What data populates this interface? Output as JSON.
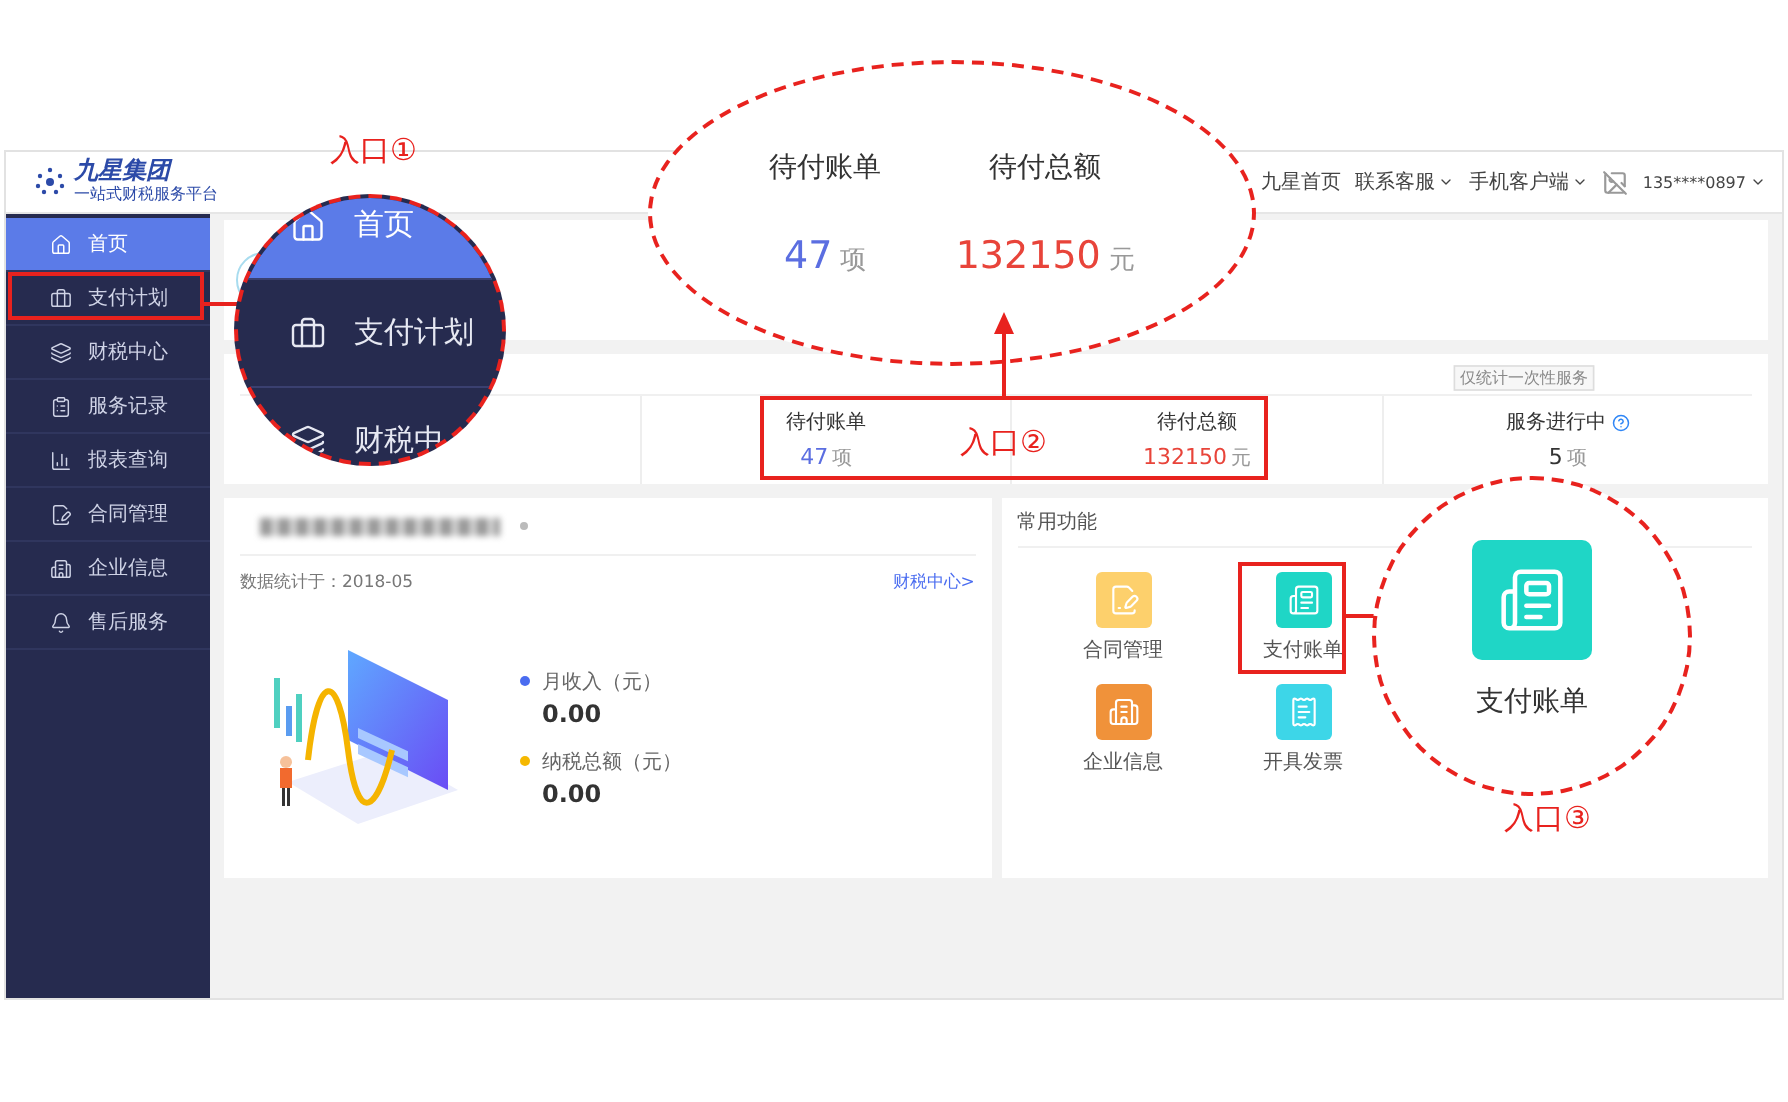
{
  "header": {
    "logo_title": "九星集团",
    "logo_subtitle": "一站式财税服务平台",
    "links": [
      {
        "label": "九星首页",
        "dropdown": false
      },
      {
        "label": "联系客服",
        "dropdown": true
      },
      {
        "label": "手机客户端",
        "dropdown": true
      }
    ],
    "account": {
      "phone": "135****0897",
      "dropdown": true
    }
  },
  "sidebar": {
    "items": [
      {
        "label": "首页",
        "selected": true
      },
      {
        "label": "支付计划",
        "selected": false
      },
      {
        "label": "财税中心",
        "selected": false
      },
      {
        "label": "服务记录",
        "selected": false
      },
      {
        "label": "报表查询",
        "selected": false
      },
      {
        "label": "合同管理",
        "selected": false
      },
      {
        "label": "企业信息",
        "selected": false
      },
      {
        "label": "售后服务",
        "selected": false
      }
    ]
  },
  "stats": {
    "tooltip": "仅统计一次性服务",
    "items": [
      {
        "label": "待付账单",
        "value": "47",
        "unit": "项",
        "color": "#5b6ee1",
        "help": false
      },
      {
        "label": "待付总额",
        "value": "132150",
        "unit": "元",
        "color": "#e8443a",
        "help": false
      },
      {
        "label": "服务进行中",
        "value": "5",
        "unit": "项",
        "color": "#333333",
        "help": true
      }
    ]
  },
  "tax_card": {
    "date_label": "数据统计于：2018-05",
    "link": "财税中心>",
    "metrics": [
      {
        "label": "月收入（元）",
        "value": "0.00",
        "color": "#4a6cf0"
      },
      {
        "label": "纳税总额（元）",
        "value": "0.00",
        "color": "#f5b800"
      }
    ]
  },
  "shortcuts": {
    "title": "常用功能",
    "items": [
      {
        "label": "合同管理",
        "color": "#fdd06c"
      },
      {
        "label": "支付账单",
        "color": "#1fd6c6"
      },
      {
        "label": "企业信息",
        "color": "#f0923a"
      },
      {
        "label": "开具发票",
        "color": "#3dd6e8"
      }
    ]
  },
  "annotations": {
    "entry_1": {
      "label": "入口①",
      "magnified_items": [
        {
          "label": "首页",
          "selected": true
        },
        {
          "label": "支付计划",
          "selected": false
        },
        {
          "label": "财税中",
          "selected": false
        }
      ]
    },
    "entry_2": {
      "label": "入口②",
      "magnified_stats": [
        {
          "label": "待付账单",
          "value": "47",
          "unit": "项",
          "color": "#5b6ee1"
        },
        {
          "label": "待付总额",
          "value": "132150",
          "unit": "元",
          "color": "#e8443a"
        }
      ]
    },
    "entry_3": {
      "label": "入口③",
      "magnified_tile": {
        "label": "支付账单",
        "color": "#1fd6c6"
      }
    }
  }
}
